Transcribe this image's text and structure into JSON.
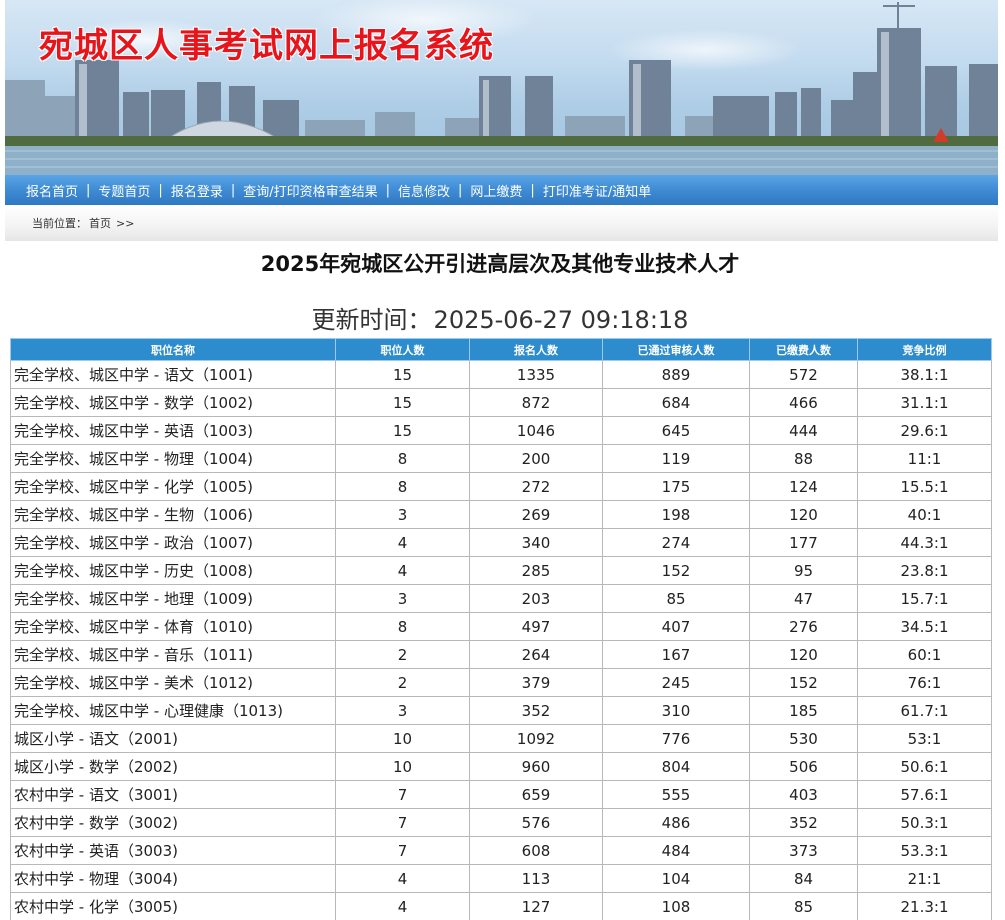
{
  "banner": {
    "title": "宛城区人事考试网上报名系统"
  },
  "nav": {
    "items": [
      "报名首页",
      "专题首页",
      "报名登录",
      "查询/打印资格审查结果",
      "信息修改",
      "网上缴费",
      "打印准考证/通知单"
    ],
    "separator": "|"
  },
  "breadcrumb": {
    "label": "当前位置：",
    "home": "首页",
    "arrow": ">>"
  },
  "page": {
    "title": "2025年宛城区公开引进高层次及其他专业技术人才",
    "update_label": "更新时间：",
    "update_time": "2025-06-27 09:18:18"
  },
  "table": {
    "headers": [
      "职位名称",
      "职位人数",
      "报名人数",
      "已通过审核人数",
      "已缴费人数",
      "竞争比例"
    ],
    "rows": [
      [
        "完全学校、城区中学 - 语文（1001)",
        "15",
        "1335",
        "889",
        "572",
        "38.1:1"
      ],
      [
        "完全学校、城区中学 - 数学（1002)",
        "15",
        "872",
        "684",
        "466",
        "31.1:1"
      ],
      [
        "完全学校、城区中学 - 英语（1003)",
        "15",
        "1046",
        "645",
        "444",
        "29.6:1"
      ],
      [
        "完全学校、城区中学 - 物理（1004)",
        "8",
        "200",
        "119",
        "88",
        "11:1"
      ],
      [
        "完全学校、城区中学 - 化学（1005)",
        "8",
        "272",
        "175",
        "124",
        "15.5:1"
      ],
      [
        "完全学校、城区中学 - 生物（1006)",
        "3",
        "269",
        "198",
        "120",
        "40:1"
      ],
      [
        "完全学校、城区中学 - 政治（1007)",
        "4",
        "340",
        "274",
        "177",
        "44.3:1"
      ],
      [
        "完全学校、城区中学 - 历史（1008)",
        "4",
        "285",
        "152",
        "95",
        "23.8:1"
      ],
      [
        "完全学校、城区中学 - 地理（1009)",
        "3",
        "203",
        "85",
        "47",
        "15.7:1"
      ],
      [
        "完全学校、城区中学 - 体育（1010)",
        "8",
        "497",
        "407",
        "276",
        "34.5:1"
      ],
      [
        "完全学校、城区中学 - 音乐（1011)",
        "2",
        "264",
        "167",
        "120",
        "60:1"
      ],
      [
        "完全学校、城区中学 - 美术（1012)",
        "2",
        "379",
        "245",
        "152",
        "76:1"
      ],
      [
        "完全学校、城区中学 - 心理健康（1013)",
        "3",
        "352",
        "310",
        "185",
        "61.7:1"
      ],
      [
        "城区小学 - 语文（2001)",
        "10",
        "1092",
        "776",
        "530",
        "53:1"
      ],
      [
        "城区小学 - 数学（2002)",
        "10",
        "960",
        "804",
        "506",
        "50.6:1"
      ],
      [
        "农村中学 - 语文（3001)",
        "7",
        "659",
        "555",
        "403",
        "57.6:1"
      ],
      [
        "农村中学 - 数学（3002)",
        "7",
        "576",
        "486",
        "352",
        "50.3:1"
      ],
      [
        "农村中学 - 英语（3003)",
        "7",
        "608",
        "484",
        "373",
        "53.3:1"
      ],
      [
        "农村中学 - 物理（3004)",
        "4",
        "113",
        "104",
        "84",
        "21:1"
      ],
      [
        "农村中学 - 化学（3005)",
        "4",
        "127",
        "108",
        "85",
        "21.3:1"
      ]
    ]
  }
}
